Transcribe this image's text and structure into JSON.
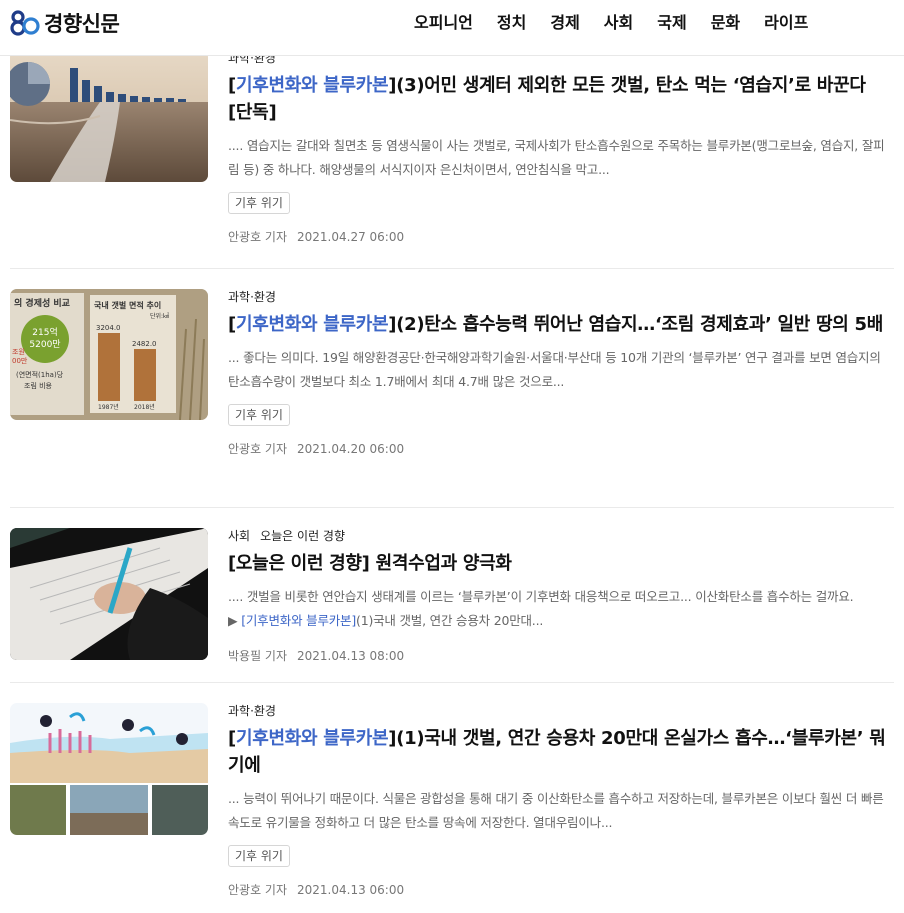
{
  "header": {
    "logo_text": "경향신문",
    "nav": [
      "오피니언",
      "정치",
      "경제",
      "사회",
      "국제",
      "문화",
      "라이프"
    ]
  },
  "articles": [
    {
      "category": "과학·환경",
      "category2": "",
      "series": "기후변화와 블루카본",
      "title_rest": "(3)어민 생계터 제외한 모든 갯벌, 탄소 먹는 ‘염습지’로 바꾼다 [단독]",
      "summary": ".... 염습지는 갈대와 칠면초 등 염생식물이 사는 갯벌로, 국제사회가 탄소흡수원으로 주목하는 블루카본(맹그로브숲, 염습지, 잘피림 등) 중 하나다. 해양생물의 서식지이자 은신처이면서, 연안침식을 막고...",
      "tag": "기후 위기",
      "author": "안광호 기자",
      "date": "2021.04.27 06:00"
    },
    {
      "category": "과학·환경",
      "category2": "",
      "series": "기후변화와 블루카본",
      "title_rest": "(2)탄소 흡수능력 뛰어난 염습지…‘조림 경제효과’ 일반 땅의 5배",
      "summary": "... 좋다는 의미다. 19일 해양환경공단·한국해양과학기술원·서울대·부산대 등 10개 기관의 ‘블루카본’ 연구 결과를 보면 염습지의 탄소흡수량이 갯벌보다 최소 1.7배에서 최대 4.7배 많은 것으로...",
      "tag": "기후 위기",
      "author": "안광호 기자",
      "date": "2021.04.20 06:00",
      "thumb_labels": {
        "left_title": "의 경제성 비교",
        "bubble_top": "215억",
        "bubble_bottom": "5200만",
        "left_small1": "조원",
        "left_small2": "00만",
        "left_note1": "(연면적(1ha)당",
        "left_note2": "조림 비용",
        "right_title": "국내 갯벌 면적 추이",
        "right_unit": "단위:㎢",
        "bar1_value": "3204.0",
        "bar2_value": "2482.0",
        "bar1_label": "1987년",
        "bar2_label": "2018년"
      }
    },
    {
      "category": "사회",
      "category2": "오늘은 이런 경향",
      "series": "",
      "title_rest": "[오늘은 이런 경향] 원격수업과 양극화",
      "summary": ".... 갯벌을 비롯한 연안습지 생태계를 이르는 ‘블루카본’이 기후변화 대응책으로 떠오르고... 이산화탄소를 흡수하는 걸까요.",
      "summary_link_prefix": "▶ ",
      "summary_link_series": "[기후변화와 블루카본]",
      "summary_link_rest": "(1)국내 갯벌, 연간 승용차 20만대...",
      "tag": "",
      "author": "박용필 기자",
      "date": "2021.04.13 08:00"
    },
    {
      "category": "과학·환경",
      "category2": "",
      "series": "기후변화와 블루카본",
      "title_rest": "(1)국내 갯벌, 연간 승용차 20만대 온실가스 흡수…‘블루카본’ 뭐기에",
      "summary": "... 능력이 뛰어나기 때문이다. 식물은 광합성을 통해 대기 중 이산화탄소를 흡수하고 저장하는데, 블루카본은 이보다 훨씬 더 빠른 속도로 유기물을 정화하고 더 많은 탄소를 땅속에 저장한다. 열대우림이나...",
      "tag": "기후 위기",
      "author": "안광호 기자",
      "date": "2021.04.13 06:00"
    }
  ]
}
